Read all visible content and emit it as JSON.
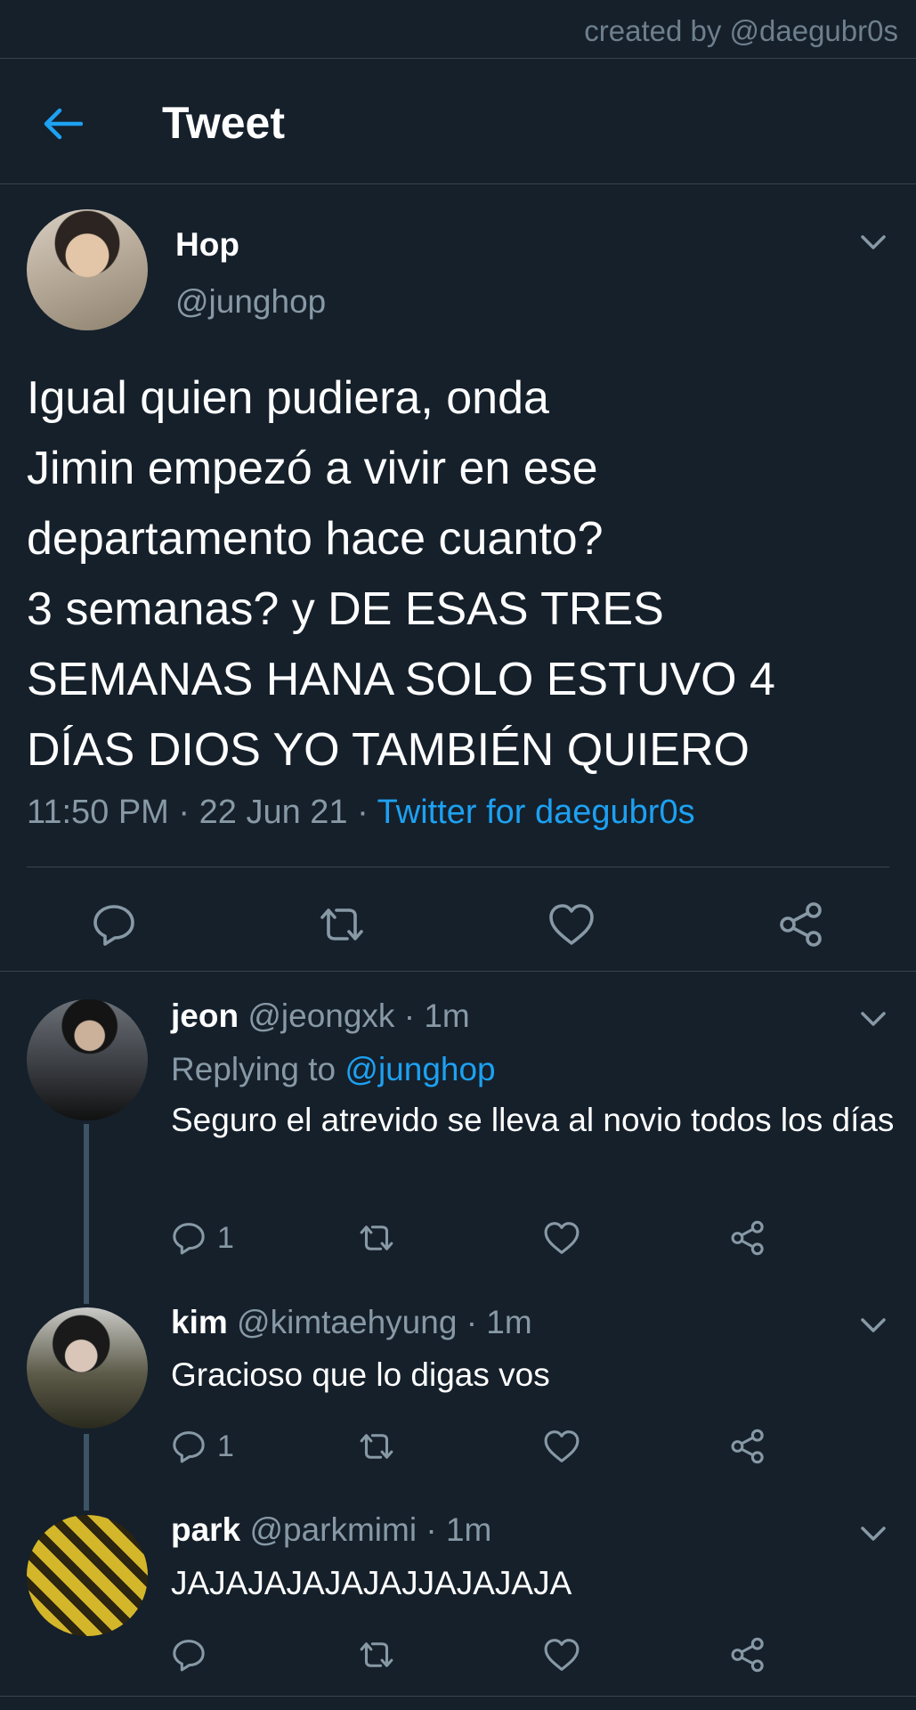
{
  "watermark": "created by @daegubr0s",
  "header": {
    "title": "Tweet",
    "back_icon": "arrow-left-icon"
  },
  "colors": {
    "background": "#15202b",
    "accent": "#1da1f2",
    "muted": "#8899a6",
    "divider": "#38444d"
  },
  "main_tweet": {
    "name": "Hop",
    "handle": "@junghop",
    "text": "Igual quien pudiera, onda\nJimin empezó a vivir en ese\ndepartamento hace cuanto?\n3 semanas? y DE ESAS TRES\nSEMANAS HANA SOLO ESTUVO 4\nDÍAS DIOS YO TAMBIÉN QUIERO",
    "time": "11:50 PM",
    "sep": " · ",
    "date": "22 Jun 21",
    "source": "Twitter for daegubr0s",
    "actions": [
      "reply-icon",
      "retweet-icon",
      "like-icon",
      "share-icon"
    ]
  },
  "replies": [
    {
      "name": "jeon",
      "handle": "@jeongxk",
      "time": "· 1m",
      "replying_label": "Replying to",
      "replying_to": "@junghop",
      "text": "Seguro el atrevido se lleva al novio todos los días",
      "reply_count": "1"
    },
    {
      "name": "kim",
      "handle": "@kimtaehyung",
      "time": "· 1m",
      "text": "Gracioso que lo digas vos",
      "reply_count": "1"
    },
    {
      "name": "park",
      "handle": "@parkmimi",
      "time": "· 1m",
      "text": "JAJAJAJAJAJAJJAJAJAJA",
      "reply_count": ""
    }
  ]
}
